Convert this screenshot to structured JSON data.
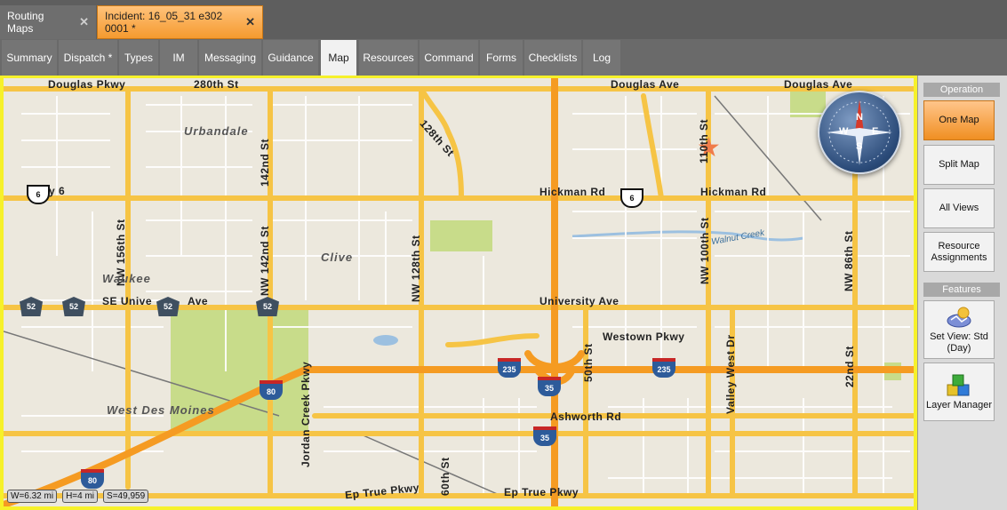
{
  "doc_tabs": [
    {
      "label": "Routing Maps",
      "close": "✕"
    },
    {
      "label": "Incident: 16_05_31 e302 0001 *",
      "close": "✕"
    }
  ],
  "nav_tabs": [
    "Summary",
    "Dispatch *",
    "Types",
    "IM",
    "Messaging",
    "Guidance",
    "Map",
    "Resources",
    "Command",
    "Forms",
    "Checklists",
    "Log"
  ],
  "active_nav": "Map",
  "map": {
    "labels": {
      "douglas_pkwy": "Douglas Pkwy",
      "st_280": "280th St",
      "douglas_ave": "Douglas Ave",
      "douglas_ave_2": "Douglas Ave",
      "urbandale": "Urbandale",
      "st_128": "128th St",
      "st_142nd": "142nd St",
      "nw_156": "NW 156th St",
      "hwy6": "kwy 6",
      "hickman_rd": "Hickman Rd",
      "hickman_rd_2": "Hickman Rd",
      "nw_142": "NW 142nd St",
      "nw_128": "NW 128th St",
      "clive": "Clive",
      "nw_100": "NW 100th St",
      "walnut_creek": "Walnut Creek",
      "nw_86": "NW 86th St",
      "st_110": "110th St",
      "waukee": "Waukee",
      "se_univ": "SE Unive",
      "ave": "Ave",
      "university_ave": "University Ave",
      "westown": "Westown Pkwy",
      "st_50": "50th St",
      "valley_west": "Valley West Dr",
      "st_22": "22nd St",
      "wdm": "West Des Moines",
      "jordan": "Jordan Creek Pkwy",
      "ashworth": "Ashworth Rd",
      "st_60": "60th St",
      "ep_true": "Ep True Pkwy",
      "ep_true_2": "Ep True Pkwy"
    },
    "shields": {
      "us6a": "6",
      "us6b": "6",
      "s52a": "52",
      "s52b": "52",
      "s52c": "52",
      "s52d": "52",
      "i80a": "80",
      "i80b": "80",
      "i235a": "235",
      "i235b": "235",
      "i35a": "35",
      "i35b": "35"
    },
    "compass": {
      "n": "N",
      "e": "E",
      "s": "S",
      "w": "W"
    },
    "scale": {
      "width": "W=6.32 mi",
      "height": "H=4 mi",
      "scale": "S=49,959"
    }
  },
  "side": {
    "operation_header": "Operation",
    "buttons": [
      "One Map",
      "Split Map",
      "All Views",
      "Resource Assignments"
    ],
    "features_header": "Features",
    "features": [
      "Set View: Std (Day)",
      "Layer Manager"
    ]
  },
  "colors": {
    "accent_orange": "#f59a2f",
    "map_frame": "#f6f12a",
    "road": "#f6c445",
    "highway": "#f59b22"
  }
}
